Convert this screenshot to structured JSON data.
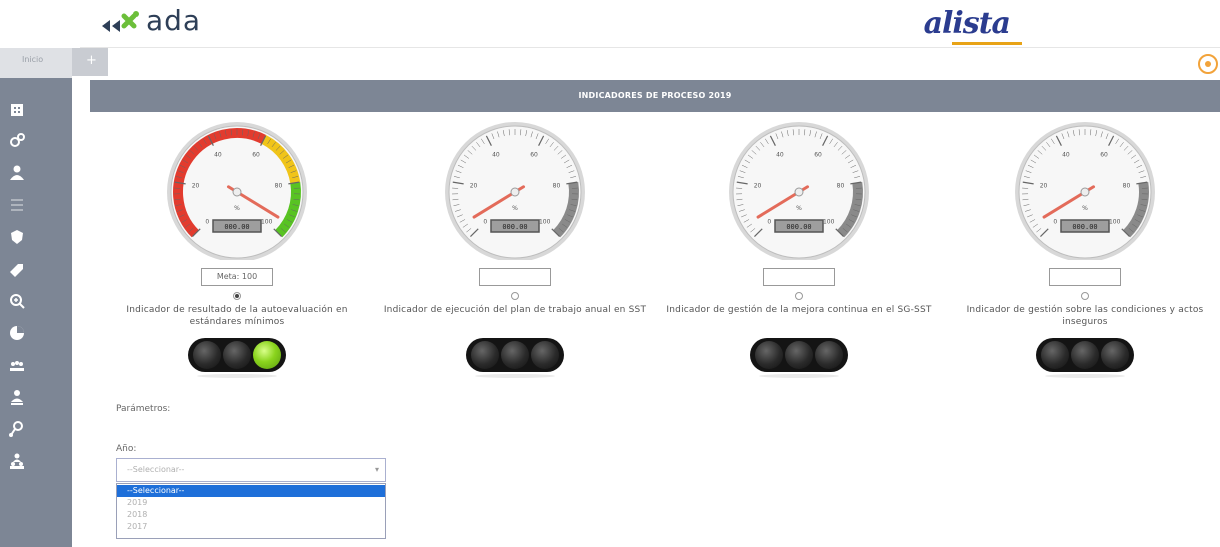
{
  "header": {
    "brand_left": "ada",
    "brand_right": "alista"
  },
  "sidebar": {
    "top_label": "Inicio",
    "toggle_symbol": "+",
    "icons": [
      "building-icon",
      "gears-icon",
      "user-icon",
      "list-icon",
      "shield-icon",
      "tag-icon",
      "zoom-in-icon",
      "pie-chart-icon",
      "people-icon",
      "user-settings-icon",
      "key-icon",
      "group-icon"
    ]
  },
  "main": {
    "title": "INDICADORES DE PROCESO 2019",
    "gauges": [
      {
        "label": "Indicador de resultado de la autoevaluación en estándares mínimos",
        "value_display": "000.00",
        "input_value": "Meta: 100",
        "colored": true,
        "selected": true,
        "light": "green"
      },
      {
        "label": "Indicador de ejecución del plan de trabajo anual en SST",
        "value_display": "000.00",
        "input_value": "",
        "colored": false,
        "selected": false,
        "light": "off"
      },
      {
        "label": "Indicador de gestión de la mejora continua en el SG-SST",
        "value_display": "000.00",
        "input_value": "",
        "colored": false,
        "selected": false,
        "light": "off"
      },
      {
        "label": "Indicador de gestión sobre las condiciones y actos inseguros",
        "value_display": "000.00",
        "input_value": "",
        "colored": false,
        "selected": false,
        "light": "off"
      }
    ],
    "gauge_ticks": [
      "0",
      "20",
      "40",
      "60",
      "80",
      "100"
    ],
    "gauge_unit": "%",
    "params_label": "Parámetros:",
    "year_label": "Año:",
    "year_select": {
      "placeholder": "--Seleccionar--",
      "options": [
        "--Seleccionar--",
        "2019",
        "2018",
        "2017"
      ]
    }
  },
  "colors": {
    "sidebar": "#7d8695",
    "title_bar": "#7d8695",
    "gauge_red": "#e23b2e",
    "gauge_yellow": "#f0c419",
    "gauge_green": "#58c322",
    "light_green": "#8ad41d",
    "select_highlight": "#1e6fd9",
    "corner_accent": "#f2a33a"
  }
}
